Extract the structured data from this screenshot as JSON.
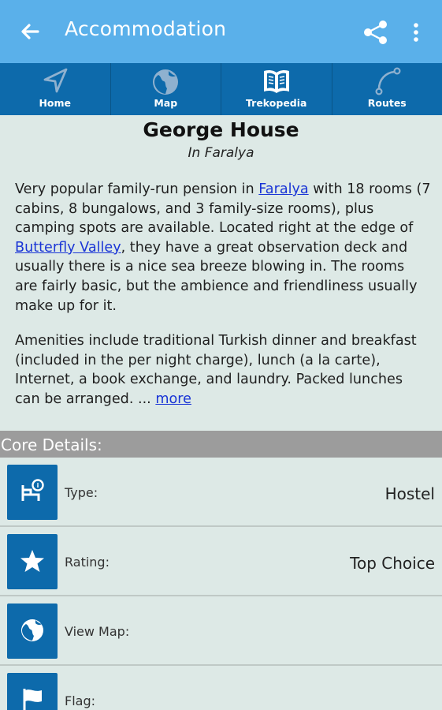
{
  "appbar": {
    "title": "Accommodation",
    "back_icon": "back-arrow-icon",
    "share_icon": "share-icon",
    "overflow_icon": "more-vert-icon",
    "color": "#5ab0ea"
  },
  "tabs": [
    {
      "label": "Home",
      "icon": "navigation-arrow-icon"
    },
    {
      "label": "Map",
      "icon": "globe-icon"
    },
    {
      "label": "Trekopedia",
      "icon": "book-icon"
    },
    {
      "label": "Routes",
      "icon": "route-icon"
    }
  ],
  "place": {
    "name": "George House",
    "location": "In Faralya",
    "para1": {
      "t1": "Very popular family-run pension in ",
      "link1": "Faralya",
      "t2": " with 18 rooms (7 cabins, 8 bungalows, and 3 family-size rooms), plus camping spots are available. Located right at the edge of ",
      "link2": "Butterfly Valley",
      "t3": ", they have a great observation deck and usually there is a nice sea breeze blowing in. The rooms are fairly basic, but the ambience and friendliness usually make up for it."
    },
    "para2": {
      "text": "Amenities include traditional Turkish dinner and breakfast (included in the per night charge), lunch (a la carte), Internet, a book exchange, and laundry. Packed lunches can be arranged. ... ",
      "more": "more"
    }
  },
  "core": {
    "header": "Core Details:",
    "rows": [
      {
        "icon": "hostel-icon",
        "label": "Type:",
        "value": "Hostel"
      },
      {
        "icon": "star-icon",
        "label": "Rating:",
        "value": "Top Choice"
      },
      {
        "icon": "globe-icon",
        "label": "View Map:",
        "value": ""
      },
      {
        "icon": "flag-icon",
        "label": "Flag:",
        "value": ""
      }
    ]
  },
  "colors": {
    "tab_bar": "#0d6aab",
    "background": "#dde9e6",
    "section": "#9c9c9c",
    "link": "#1a35d6"
  }
}
